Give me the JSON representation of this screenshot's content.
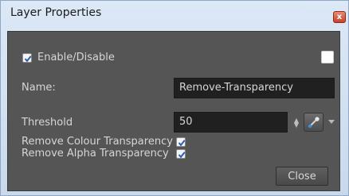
{
  "window": {
    "title": "Layer Properties",
    "close_glyph": "x"
  },
  "enable": {
    "label": "Enable/Disable",
    "checked": true
  },
  "name": {
    "label": "Name:",
    "value": "Remove-Transparency"
  },
  "threshold": {
    "label": "Threshold",
    "value": "50",
    "picker_icon": "color-picker-icon"
  },
  "remove_colour": {
    "label": "Remove Colour Transparency",
    "checked": true
  },
  "remove_alpha": {
    "label": "Remove Alpha Transparency",
    "checked": true
  },
  "buttons": {
    "close_label": "Close"
  },
  "colors": {
    "panel": "#555555",
    "field": "#202020",
    "check": "#2f5fae",
    "accent": "#3c8ee0"
  }
}
